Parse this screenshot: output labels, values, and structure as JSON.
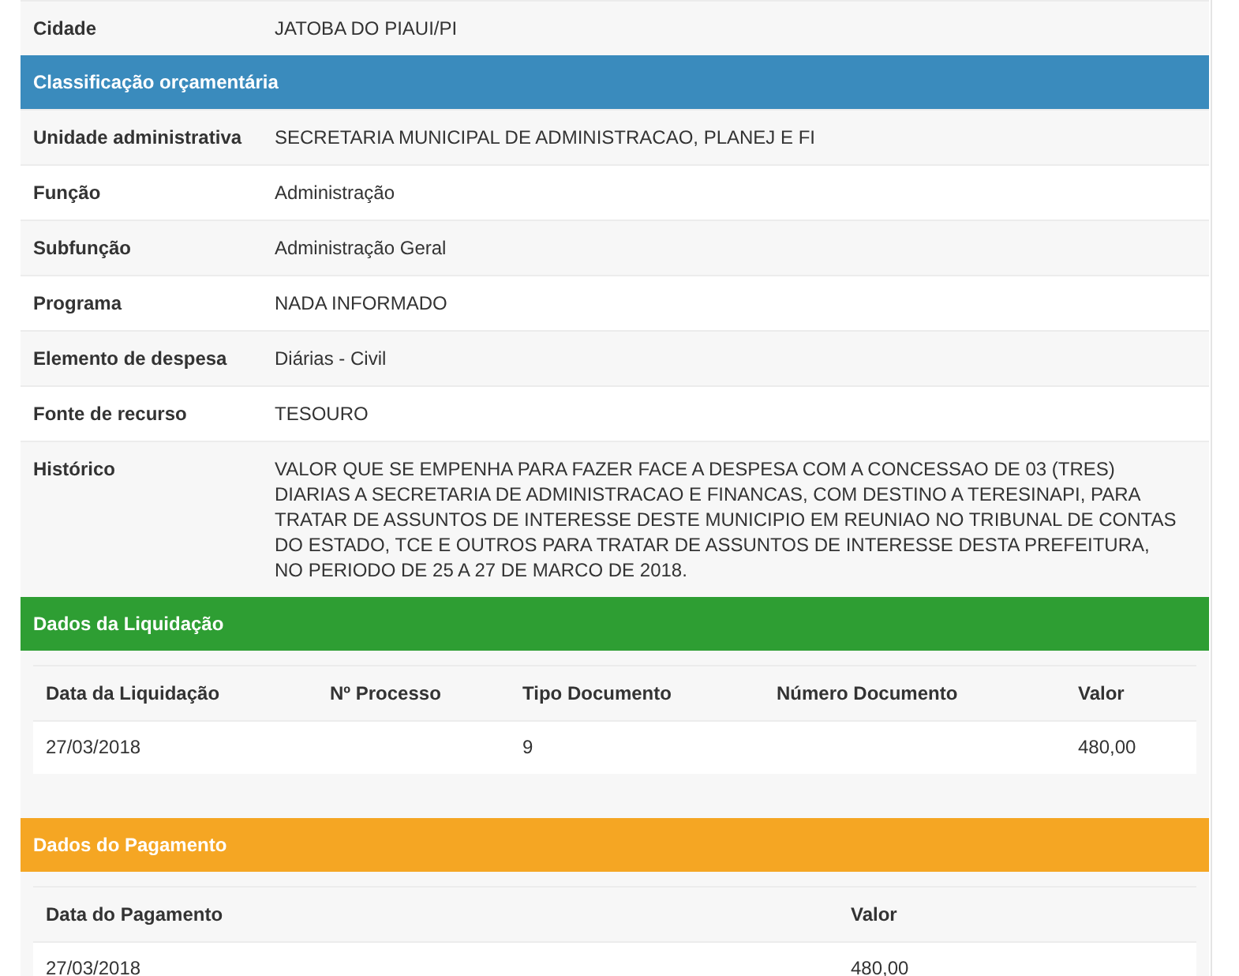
{
  "top_fields": [
    {
      "label": "Cidade",
      "value": "JATOBA DO PIAUI/PI"
    }
  ],
  "sections": [
    {
      "kind": "fields",
      "title": "Classificação orçamentária",
      "color": "#3a8bbd",
      "fields": [
        {
          "label": "Unidade administrativa",
          "value": "SECRETARIA MUNICIPAL DE ADMINISTRACAO, PLANEJ E FI"
        },
        {
          "label": "Função",
          "value": "Administração"
        },
        {
          "label": "Subfunção",
          "value": "Administração Geral"
        },
        {
          "label": "Programa",
          "value": "NADA INFORMADO"
        },
        {
          "label": "Elemento de despesa",
          "value": "Diárias - Civil"
        },
        {
          "label": "Fonte de recurso",
          "value": "TESOURO"
        },
        {
          "label": "Histórico",
          "value": "VALOR QUE SE EMPENHA PARA FAZER FACE A DESPESA COM A CONCESSAO DE 03 (TRES) DIARIAS A SECRETARIA DE ADMINISTRACAO E FINANCAS, COM DESTINO A TERESINAPI, PARA TRATAR DE ASSUNTOS DE INTERESSE DESTE MUNICIPIO EM REUNIAO NO TRIBUNAL DE CONTAS DO ESTADO, TCE E OUTROS PARA TRATAR DE ASSUNTOS DE INTERESSE DESTA PREFEITURA, NO PERIODO DE 25 A 27 DE MARCO DE 2018."
        }
      ]
    },
    {
      "kind": "table",
      "title": "Dados da Liquidação",
      "color": "#2e9e33",
      "columns": [
        "Data da Liquidação",
        "Nº Processo",
        "Tipo Documento",
        "Número Documento",
        "Valor"
      ],
      "rows": [
        [
          "27/03/2018",
          null,
          "9",
          null,
          "480,00"
        ]
      ]
    },
    {
      "kind": "table",
      "title": "Dados do Pagamento",
      "color": "#f5a623",
      "columns": [
        "Data do Pagamento",
        "Valor"
      ],
      "rows": [
        [
          "27/03/2018",
          "480,00"
        ]
      ]
    }
  ]
}
